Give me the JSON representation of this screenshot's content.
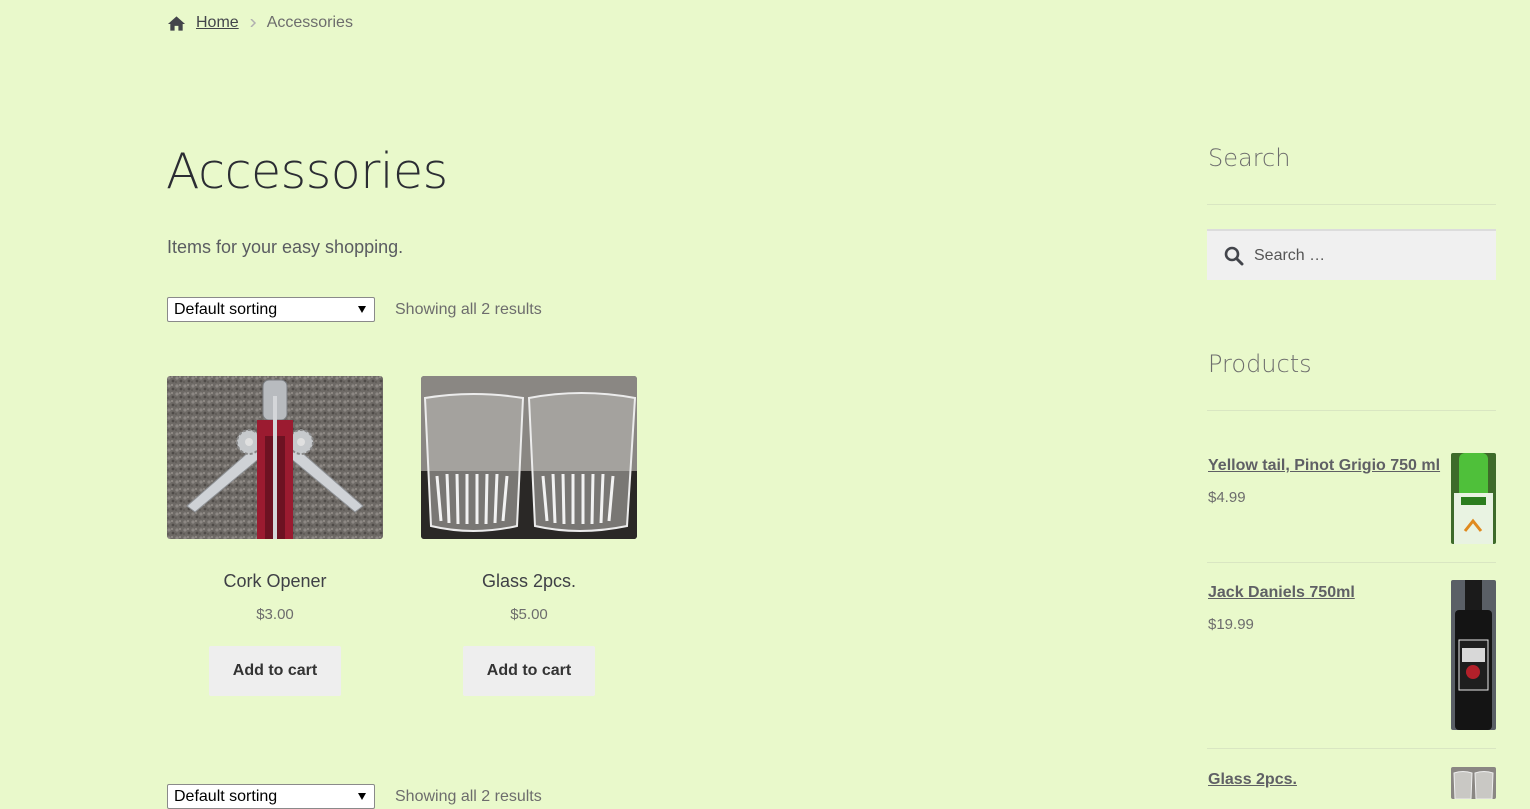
{
  "breadcrumb": {
    "home": "Home",
    "current": "Accessories"
  },
  "page": {
    "title": "Accessories",
    "description": "Items for your easy shopping."
  },
  "toolbar": {
    "sorting_selected": "Default sorting",
    "result_count": "Showing all 2 results"
  },
  "products": [
    {
      "name": "Cork Opener",
      "price": "$3.00",
      "button": "Add to cart"
    },
    {
      "name": "Glass 2pcs.",
      "price": "$5.00",
      "button": "Add to cart"
    }
  ],
  "sidebar": {
    "search": {
      "title": "Search",
      "placeholder": "Search …"
    },
    "products": {
      "title": "Products",
      "items": [
        {
          "name": "Yellow tail, Pinot Grigio 750 ml",
          "price": "$4.99"
        },
        {
          "name": "Jack Daniels 750ml",
          "price": "$19.99"
        },
        {
          "name": "Glass 2pcs.",
          "price": ""
        }
      ]
    }
  },
  "colors": {
    "background": "#e9f9cb",
    "button": "#eeeeee",
    "text": "#43454b"
  }
}
